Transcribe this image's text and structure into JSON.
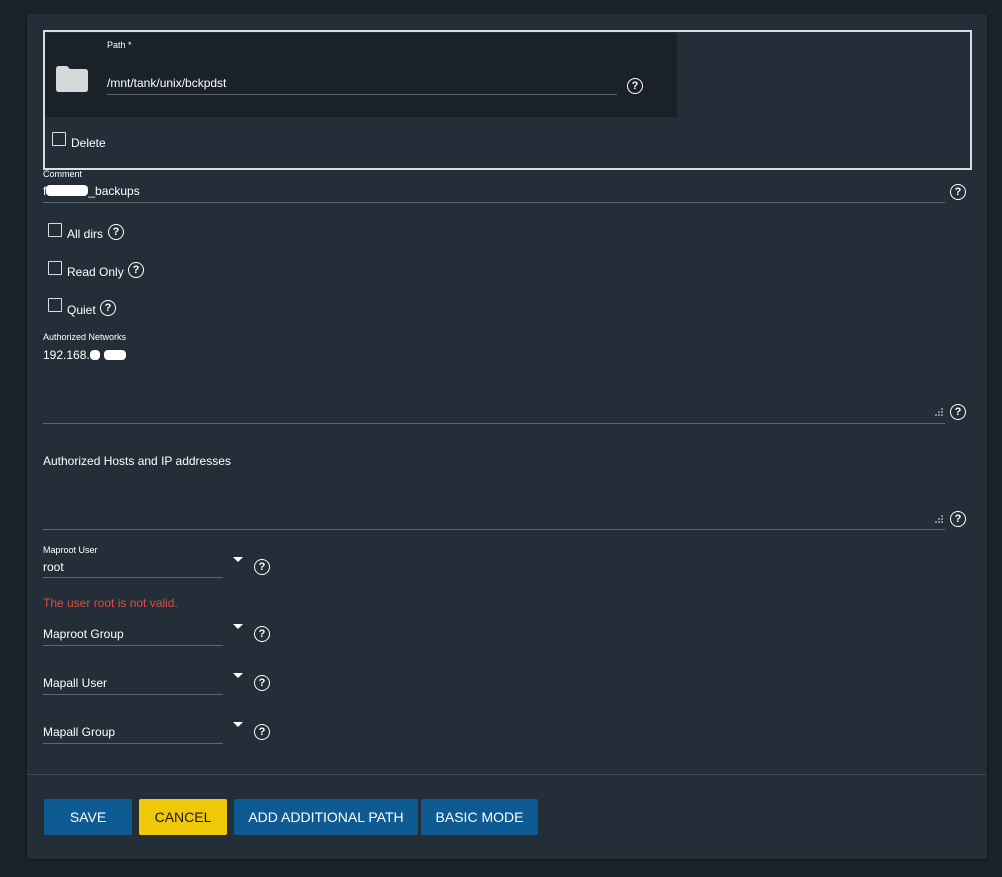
{
  "path": {
    "label": "Path *",
    "value": "/mnt/tank/unix/bckpdst",
    "delete_label": "Delete"
  },
  "comment": {
    "label": "Comment",
    "value_start": "f",
    "value_end": "_backups"
  },
  "options": {
    "all_dirs": "All dirs",
    "read_only": "Read Only",
    "quiet": "Quiet"
  },
  "networks": {
    "label": "Authorized Networks",
    "value_prefix": "192.168."
  },
  "hosts": {
    "label": "Authorized Hosts and IP addresses"
  },
  "maproot_user": {
    "label": "Maproot User",
    "value": "root",
    "error": "The user root is not valid."
  },
  "maproot_group": {
    "placeholder": "Maproot Group"
  },
  "mapall_user": {
    "placeholder": "Mapall User"
  },
  "mapall_group": {
    "placeholder": "Mapall Group"
  },
  "help_glyph": "?",
  "buttons": {
    "save": "SAVE",
    "cancel": "CANCEL",
    "add_path": "ADD ADDITIONAL PATH",
    "basic_mode": "BASIC MODE"
  },
  "colors": {
    "background": "#1b232b",
    "card": "#232e38",
    "primary": "#0e5b94",
    "accent": "#f0c80a",
    "error": "#e34a40"
  }
}
